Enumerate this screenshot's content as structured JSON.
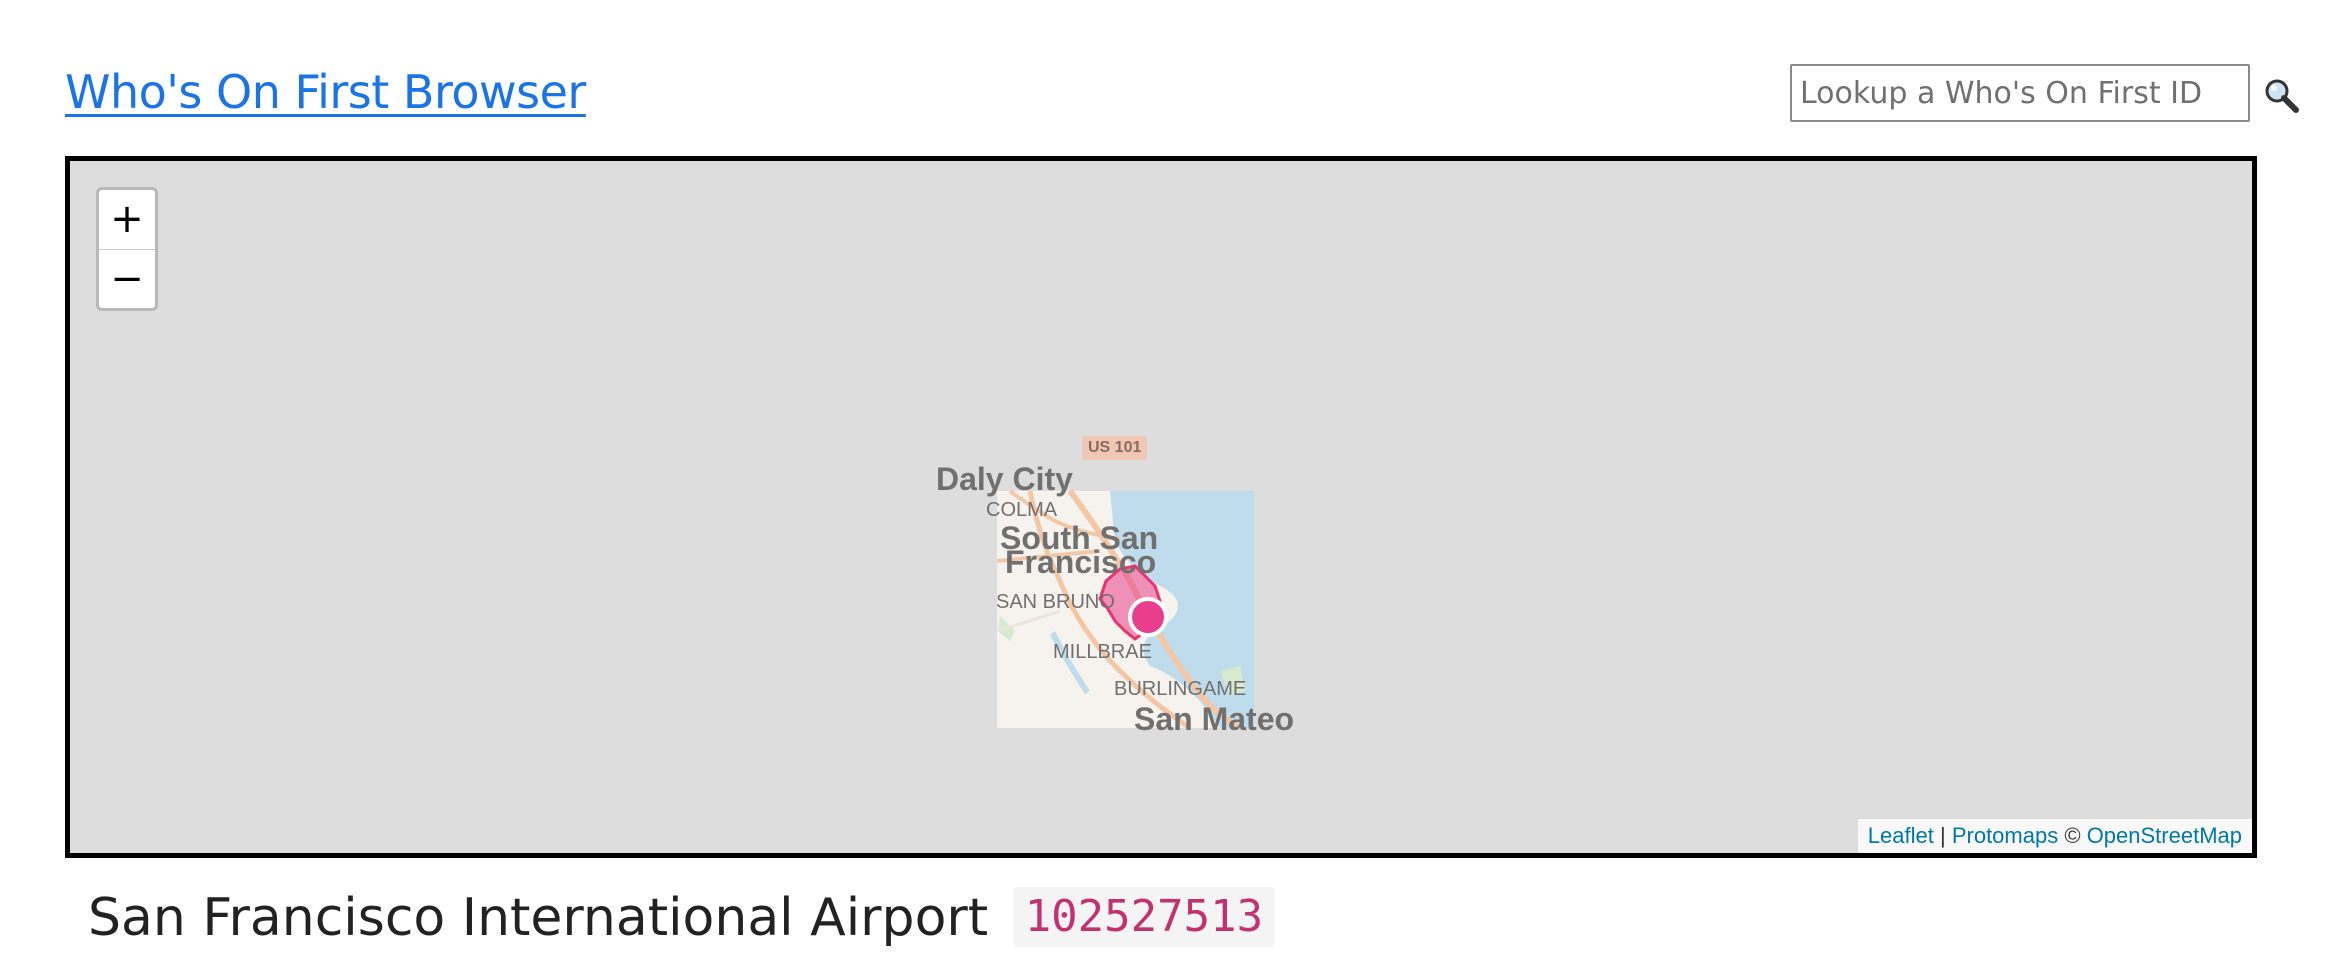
{
  "header": {
    "title": "Who's On First Browser",
    "lookup_placeholder": "Lookup a Who's On First ID",
    "search_icon": "magnifying-glass-icon"
  },
  "map": {
    "zoom_in_label": "+",
    "zoom_out_label": "−",
    "route_badge": "US 101",
    "labels": {
      "daly_city": "Daly City",
      "colma": "COLMA",
      "south_san_francisco_1": "South San",
      "south_san_francisco_2": "Francisco",
      "san_bruno": "SAN BRUNO",
      "millbrae": "MILLBRAE",
      "burlingame": "BURLINGAME",
      "san_mateo": "San Mateo"
    },
    "attribution": {
      "leaflet": "Leaflet",
      "separator": "|",
      "protomaps": "Protomaps",
      "copyright": "©",
      "osm": "OpenStreetMap"
    },
    "colors": {
      "background": "#dddddd",
      "water": "#bfdcec",
      "land": "#f6f3ee",
      "road": "#f3c7a6",
      "highlight": "#e83e8c"
    }
  },
  "place": {
    "name": "San Francisco International Airport",
    "id": "102527513"
  }
}
